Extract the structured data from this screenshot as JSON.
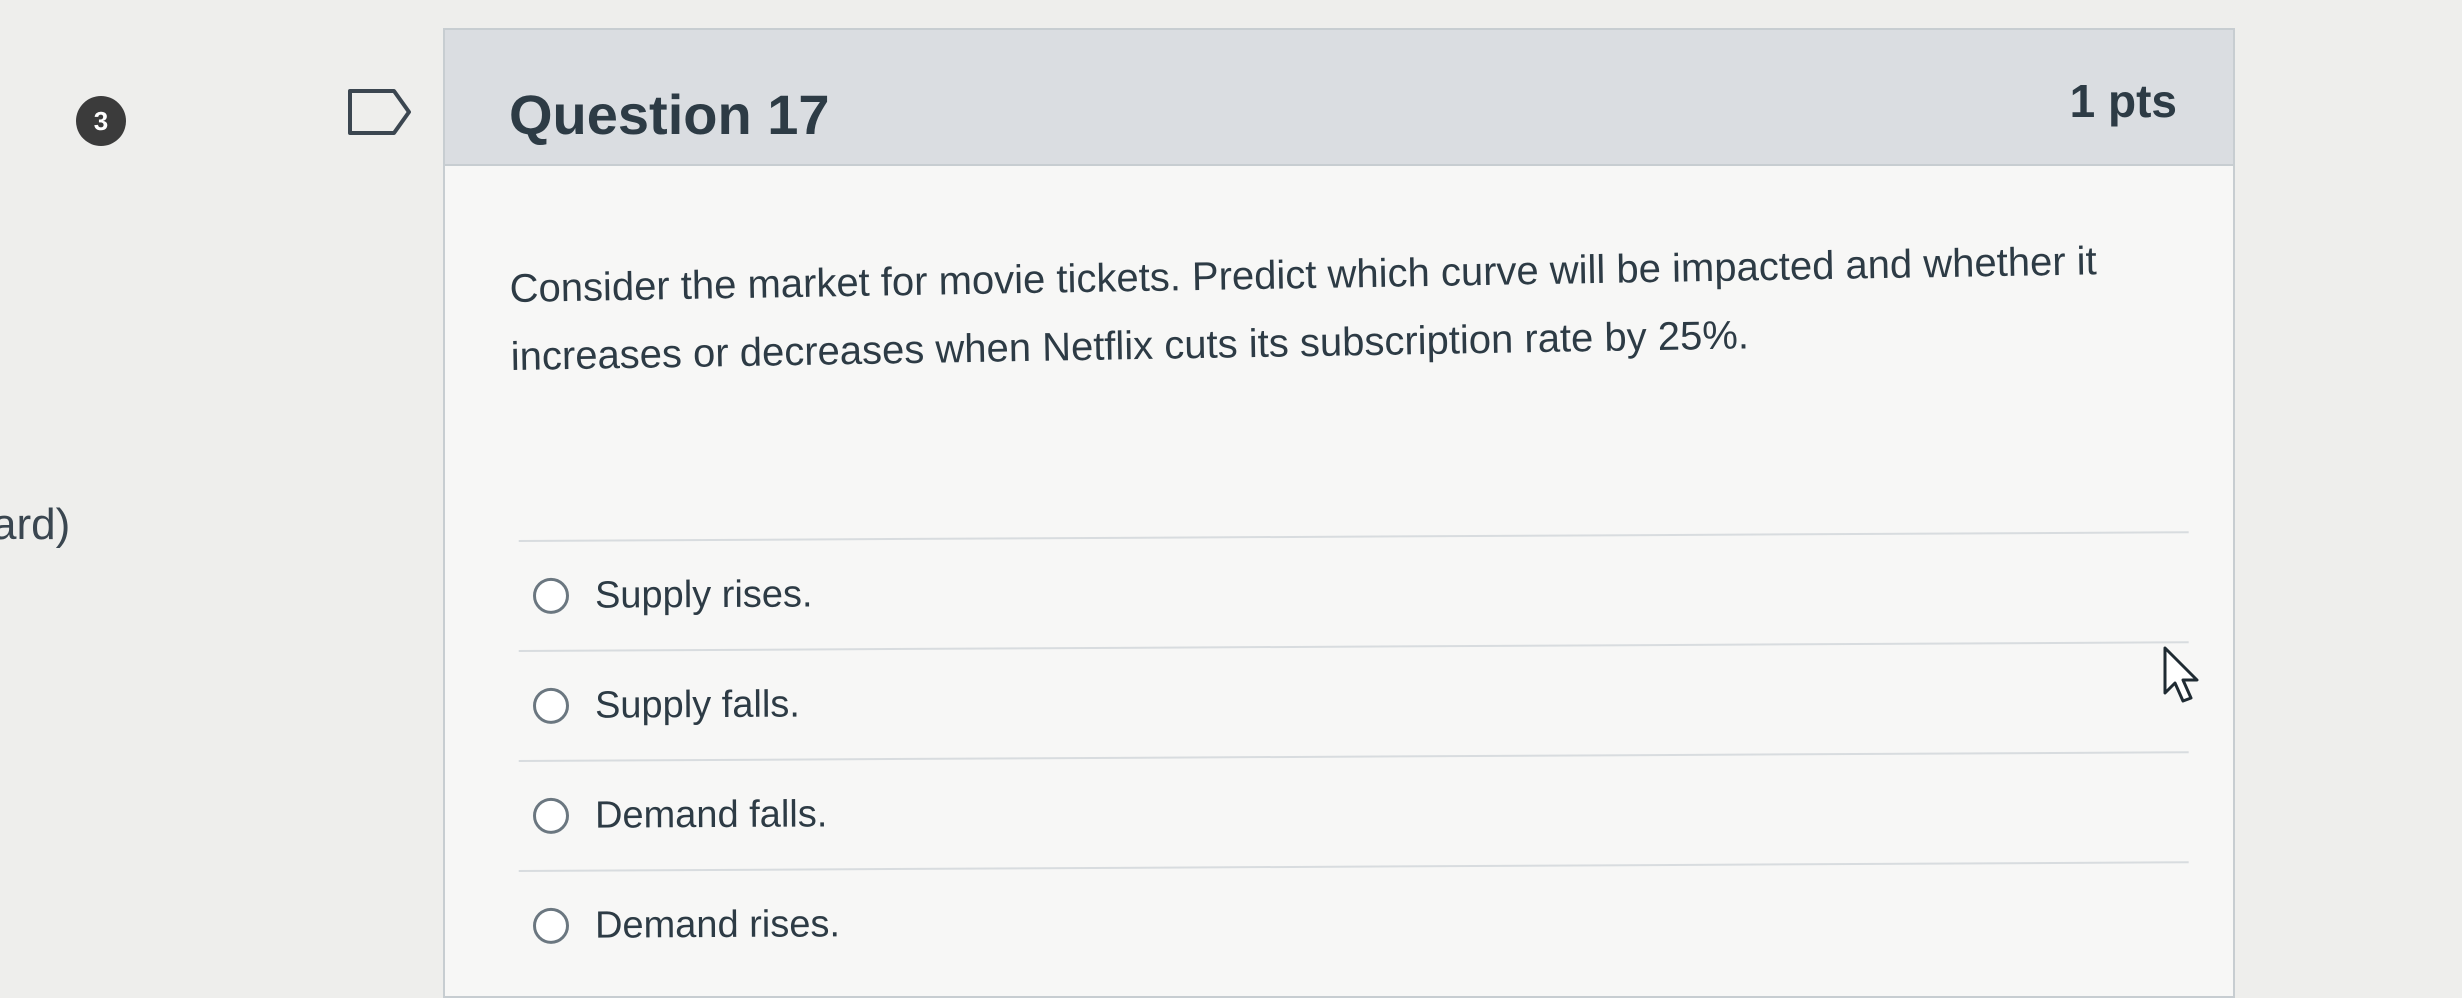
{
  "sidebar": {
    "badge_count": "3",
    "edge_text": "ard)"
  },
  "question": {
    "title": "Question 17",
    "points": "1 pts",
    "text": "Consider the market for movie tickets. Predict which curve will be impacted and whether it increases or decreases when Netflix cuts its subscription rate by 25%.",
    "answers": [
      {
        "label": "Supply rises.",
        "selected": false
      },
      {
        "label": "Supply falls.",
        "selected": false
      },
      {
        "label": "Demand falls.",
        "selected": false
      },
      {
        "label": "Demand rises.",
        "selected": false
      }
    ]
  },
  "icons": {
    "flag": "flag-outline-icon",
    "cursor": "mouse-pointer-icon"
  },
  "colors": {
    "header_background": "#dadde1",
    "text": "#2d3b45",
    "badge_background": "#3b3b3b"
  }
}
